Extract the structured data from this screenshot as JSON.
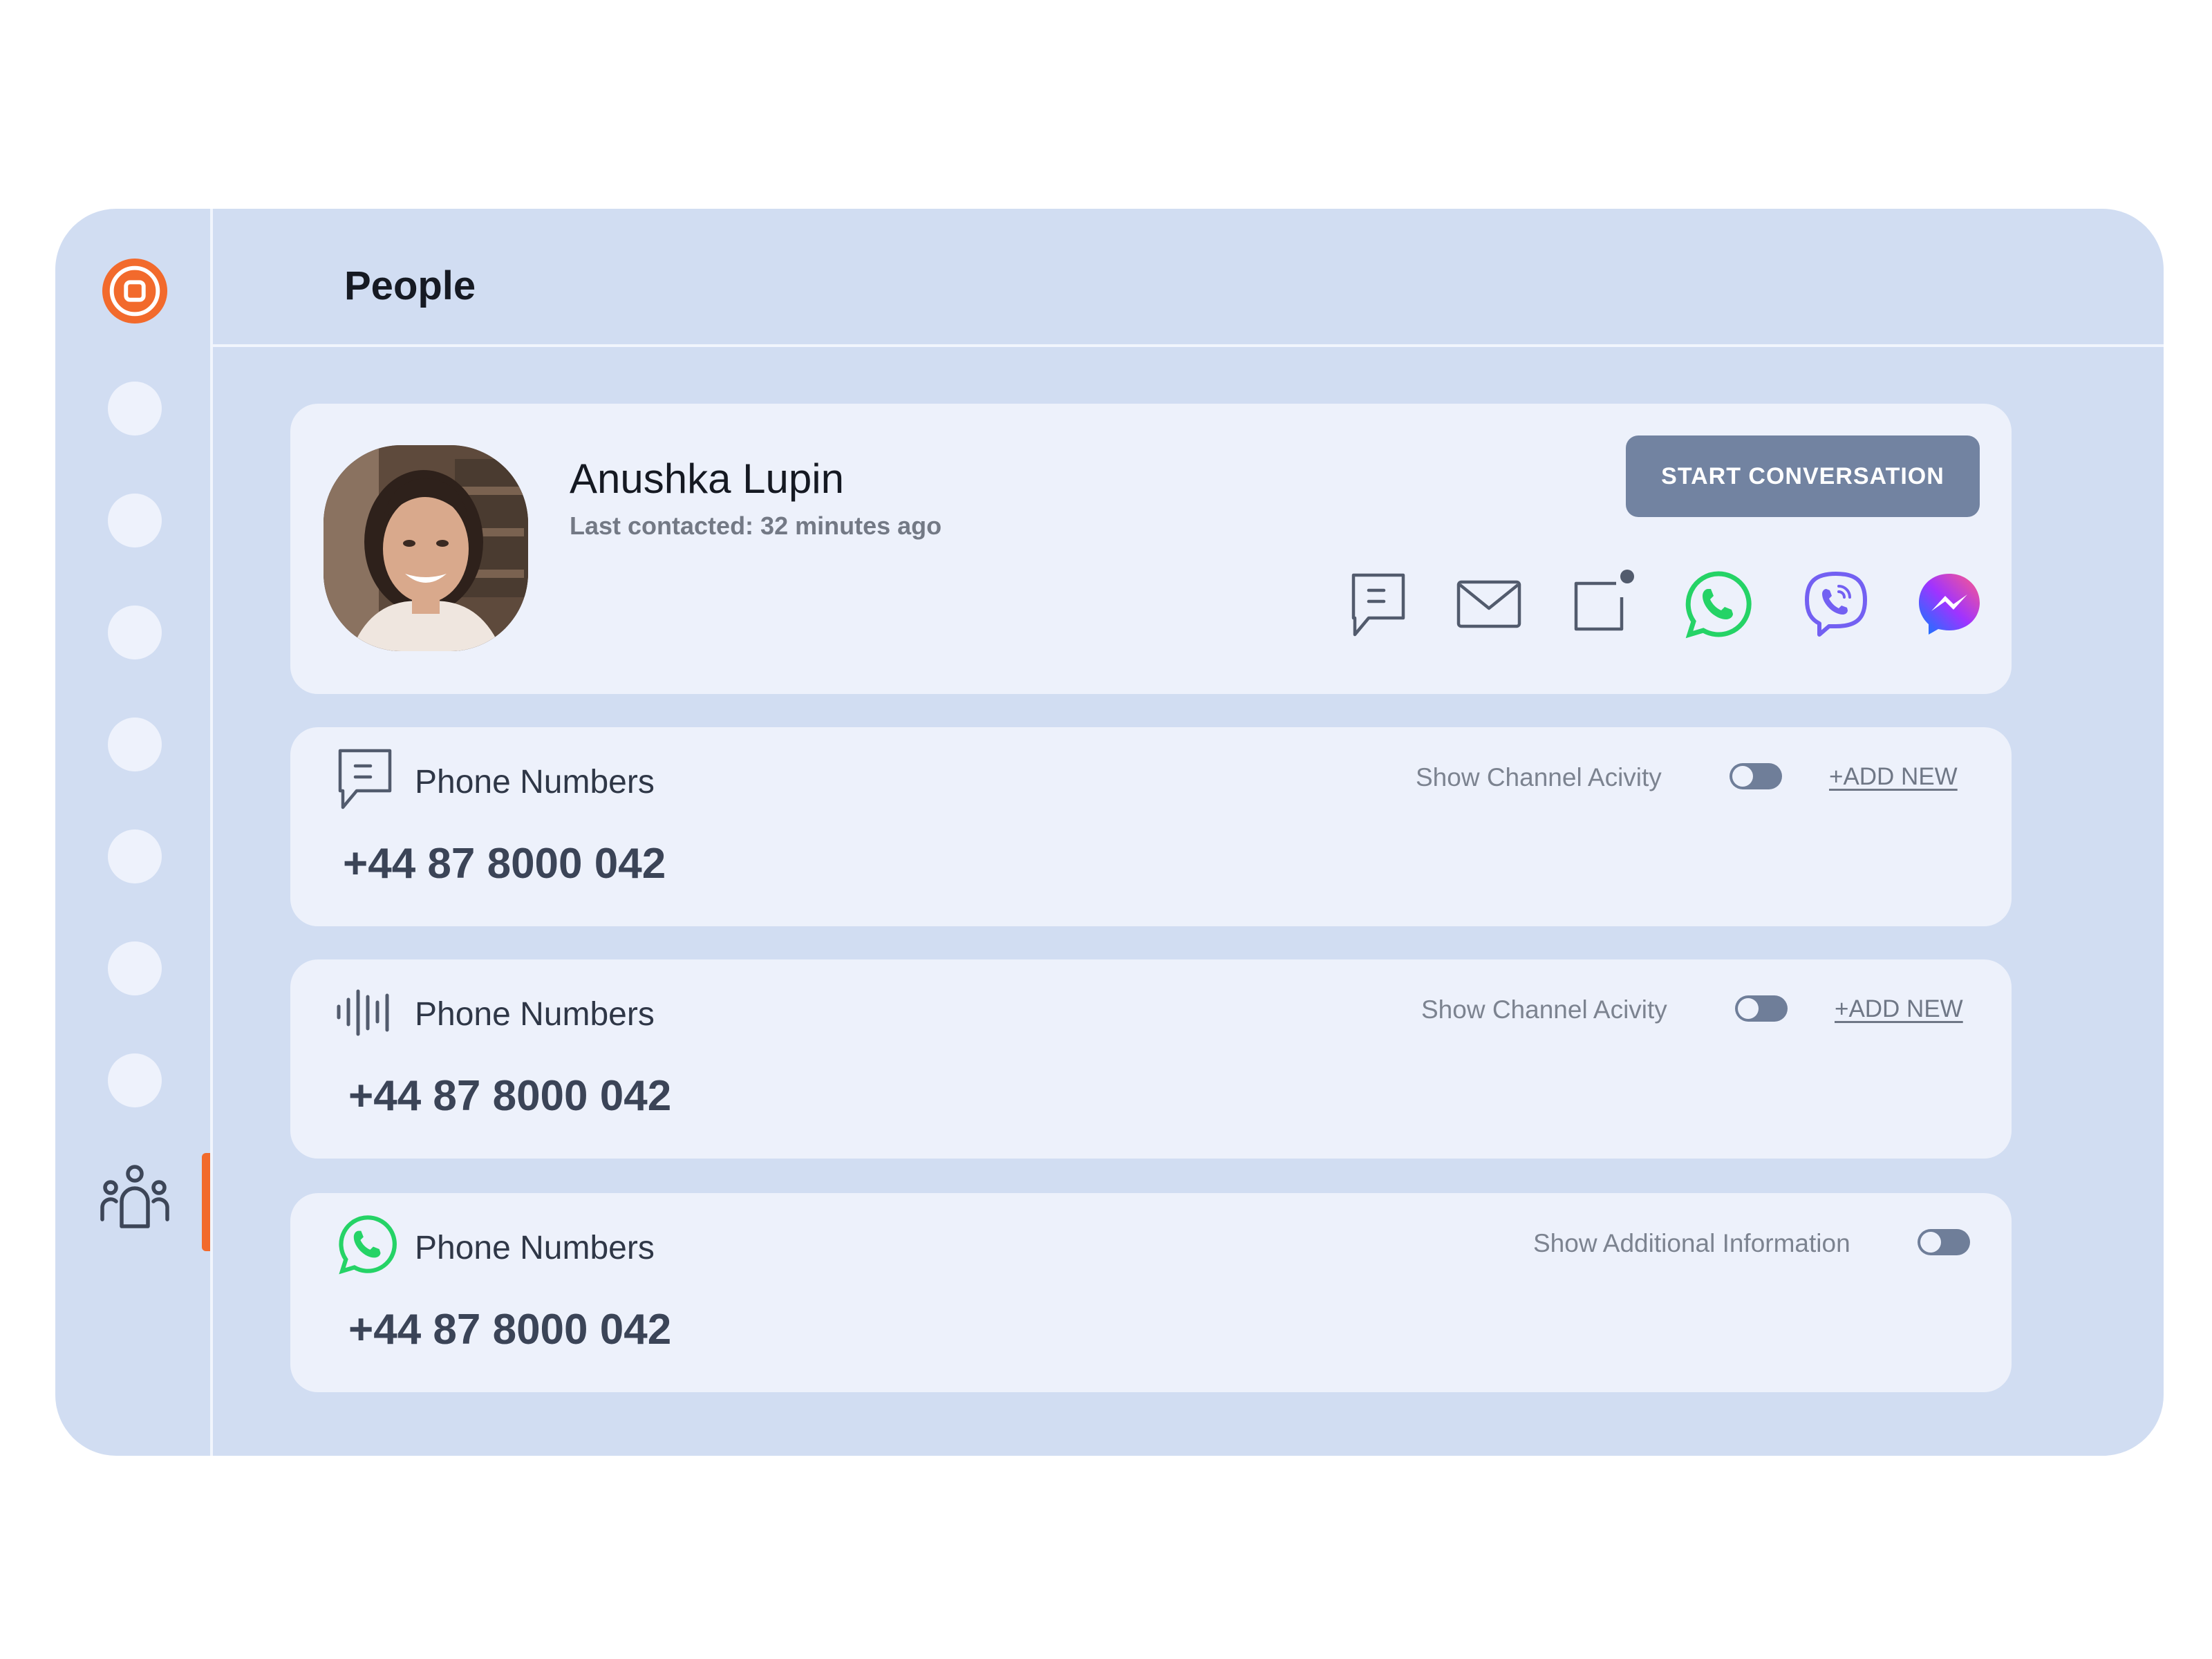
{
  "header": {
    "title": "People"
  },
  "sidebar": {
    "items": [
      {
        "icon": "nav-dot"
      },
      {
        "icon": "nav-dot"
      },
      {
        "icon": "nav-dot"
      },
      {
        "icon": "nav-dot"
      },
      {
        "icon": "nav-dot"
      },
      {
        "icon": "nav-dot"
      },
      {
        "icon": "nav-dot"
      },
      {
        "icon": "people-icon",
        "active": true
      }
    ],
    "accent_color": "#f26a2c"
  },
  "contact": {
    "name": "Anushka Lupin",
    "last_contacted": "Last contacted: 32 minutes ago",
    "start_button_label": "START CONVERSATION",
    "channels": [
      "sms-icon",
      "email-icon",
      "notification-icon",
      "whatsapp-icon",
      "viber-icon",
      "messenger-icon"
    ]
  },
  "phone_cards": [
    {
      "icon": "sms-icon",
      "title": "Phone Numbers",
      "number": "+44 87 8000 042",
      "toggle_label": "Show Channel Acivity",
      "toggle_on": false,
      "add_label": "+ADD NEW"
    },
    {
      "icon": "voice-icon",
      "title": "Phone Numbers",
      "number": "+44 87 8000 042",
      "toggle_label": "Show Channel Acivity",
      "toggle_on": false,
      "add_label": "+ADD NEW"
    },
    {
      "icon": "whatsapp-icon",
      "title": "Phone Numbers",
      "number": "+44 87 8000 042",
      "toggle_label": "Show Additional Information",
      "toggle_on": false
    }
  ],
  "colors": {
    "window_bg": "#d1ddf2",
    "card_bg": "#edf1fb",
    "button_bg": "#7283a1",
    "whatsapp": "#25d366",
    "viber": "#7360f2",
    "brand": "#f26a2c"
  }
}
